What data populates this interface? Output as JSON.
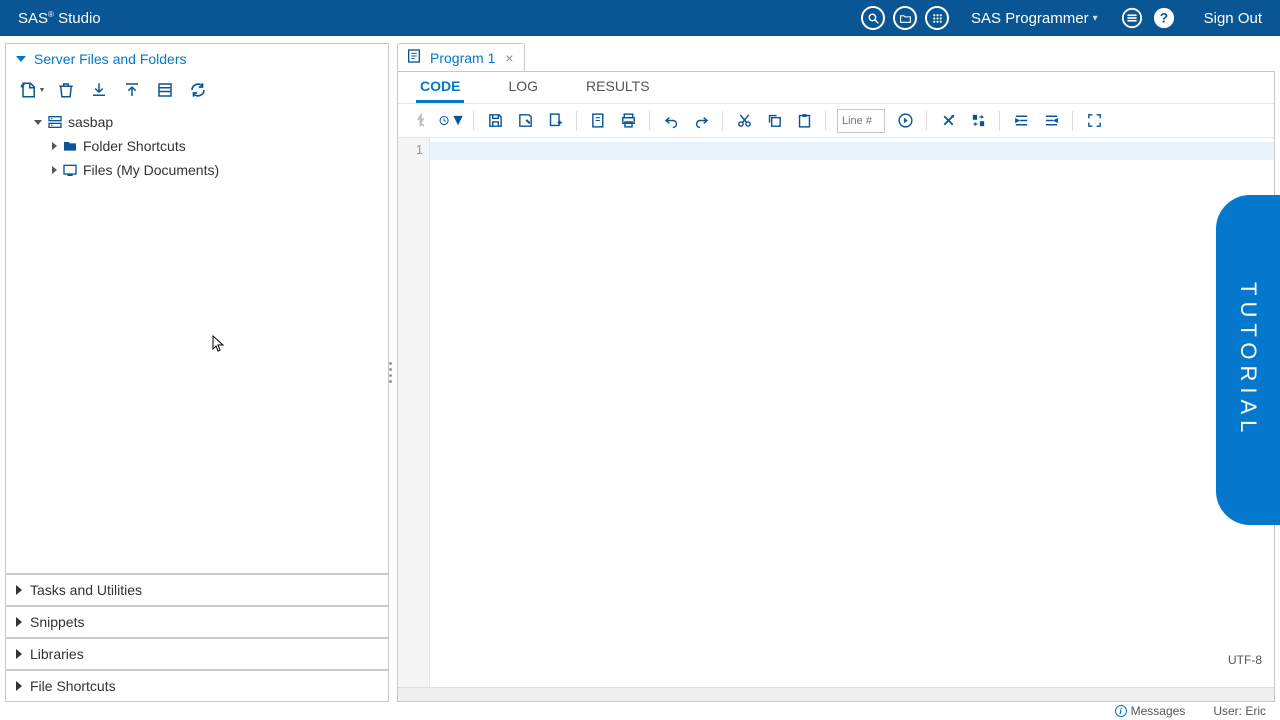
{
  "app": {
    "title_html": "SAS® Studio",
    "title_prefix": "SAS",
    "title_suffix": "Studio"
  },
  "topbar": {
    "user": "SAS Programmer",
    "signout": "Sign Out"
  },
  "sidebar": {
    "panels": {
      "files": "Server Files and Folders",
      "tasks": "Tasks and Utilities",
      "snippets": "Snippets",
      "libraries": "Libraries",
      "shortcuts": "File Shortcuts"
    },
    "tree": {
      "root": "sasbap",
      "folder_shortcuts": "Folder Shortcuts",
      "files_mydocs": "Files (My Documents)"
    }
  },
  "editor": {
    "tab_label": "Program 1",
    "subtabs": {
      "code": "CODE",
      "log": "LOG",
      "results": "RESULTS"
    },
    "line_placeholder": "Line #",
    "first_line_no": "1",
    "encoding": "UTF-8"
  },
  "status": {
    "messages": "Messages",
    "user_label": "User: Eric"
  },
  "tutorial": "TUTORIAL"
}
